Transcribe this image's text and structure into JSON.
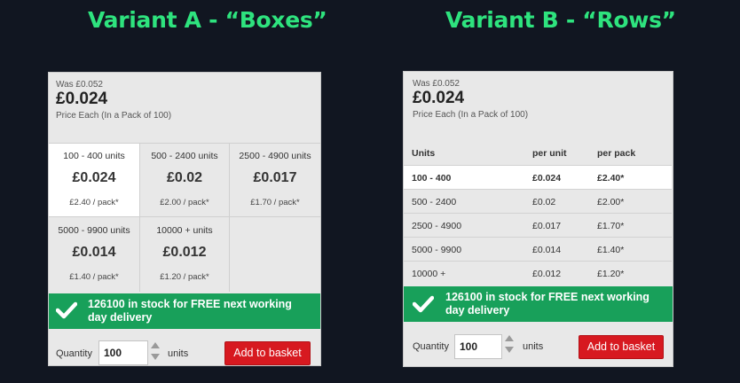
{
  "titles": {
    "a": "Variant A - “Boxes”",
    "b": "Variant B - “Rows”"
  },
  "variant_a": {
    "was": "Was £0.052",
    "price": "£0.024",
    "each": "Price Each (In a Pack of 100)",
    "boxes": [
      {
        "units": "100 - 400 units",
        "per_unit": "£0.024",
        "per_pack": "£2.40  / pack*"
      },
      {
        "units": "500 - 2400 units",
        "per_unit": "£0.02",
        "per_pack": "£2.00  / pack*"
      },
      {
        "units": "2500 - 4900 units",
        "per_unit": "£0.017",
        "per_pack": "£1.70  / pack*"
      },
      {
        "units": "5000 - 9900 units",
        "per_unit": "£0.014",
        "per_pack": "£1.40  / pack*"
      },
      {
        "units": "10000 + units",
        "per_unit": "£0.012",
        "per_pack": "£1.20  / pack*"
      }
    ],
    "stock_line1": "126100 in stock for FREE next working",
    "stock_line2": "day delivery",
    "quantity_label": "Quantity",
    "quantity_value": "100",
    "units_label": "units",
    "add_button": "Add to basket"
  },
  "variant_b": {
    "was": "Was £0.052",
    "price": "£0.024",
    "each": "Price Each (In a Pack of 100)",
    "table_headers": [
      "Units",
      "per unit",
      "per pack"
    ],
    "rows": [
      [
        "100 - 400",
        "£0.024",
        "£2.40*"
      ],
      [
        "500 - 2400",
        "£0.02",
        "£2.00*"
      ],
      [
        "2500 - 4900",
        "£0.017",
        "£1.70*"
      ],
      [
        "5000 - 9900",
        "£0.014",
        "£1.40*"
      ],
      [
        "10000 +",
        "£0.012",
        "£1.20*"
      ]
    ],
    "stock_line1": "126100 in stock for FREE next working",
    "stock_line2": "day delivery",
    "quantity_label": "Quantity",
    "quantity_value": "100",
    "units_label": "units",
    "add_button": "Add to basket"
  },
  "colors": {
    "title_green": "#2ee37e",
    "stock_green": "#18a05a",
    "button_red": "#d71920",
    "background": "#111621"
  }
}
